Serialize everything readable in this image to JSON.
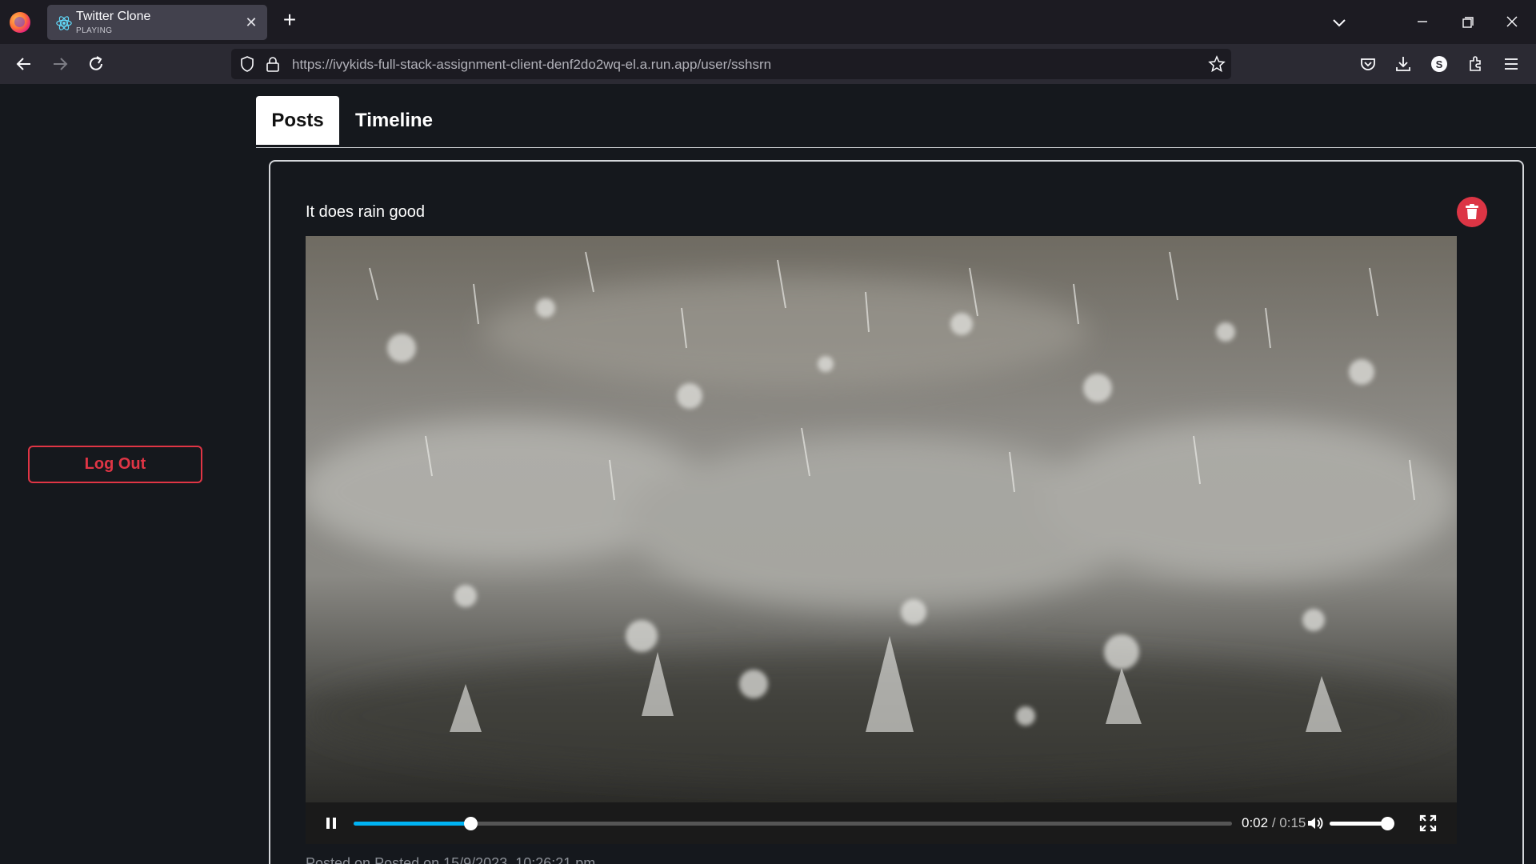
{
  "browser": {
    "tab_title": "Twitter Clone",
    "tab_status": "PLAYING",
    "url_host": "https://ivykids-full-stack-assignment-client-denf2do2wq-el.a.run.app",
    "url_path": "/user/sshsrn"
  },
  "sidebar": {
    "logout_label": "Log Out"
  },
  "tabs": {
    "posts_label": "Posts",
    "timeline_label": "Timeline",
    "active": "Posts"
  },
  "post": {
    "text": "It does rain good",
    "posted_label": "Posted on Posted on 15/9/2023, 10:26:21 pm",
    "video": {
      "current_time": "0:02",
      "separator": "/",
      "total_time": "0:15",
      "progress_fraction": 0.133,
      "volume_fraction": 1.0
    }
  },
  "colors": {
    "accent_danger": "#dc3545",
    "progress": "#00b3f4",
    "page_bg": "#15181d"
  },
  "icons": [
    "firefox-logo-icon",
    "react-icon",
    "close-icon",
    "plus-icon",
    "chevron-down-icon",
    "minimize-icon",
    "restore-icon",
    "back-arrow-icon",
    "forward-arrow-icon",
    "reload-icon",
    "shield-icon",
    "lock-icon",
    "star-icon",
    "pocket-icon",
    "download-icon",
    "account-icon",
    "extensions-icon",
    "menu-icon",
    "trash-icon",
    "pause-icon",
    "volume-icon",
    "fullscreen-icon"
  ]
}
